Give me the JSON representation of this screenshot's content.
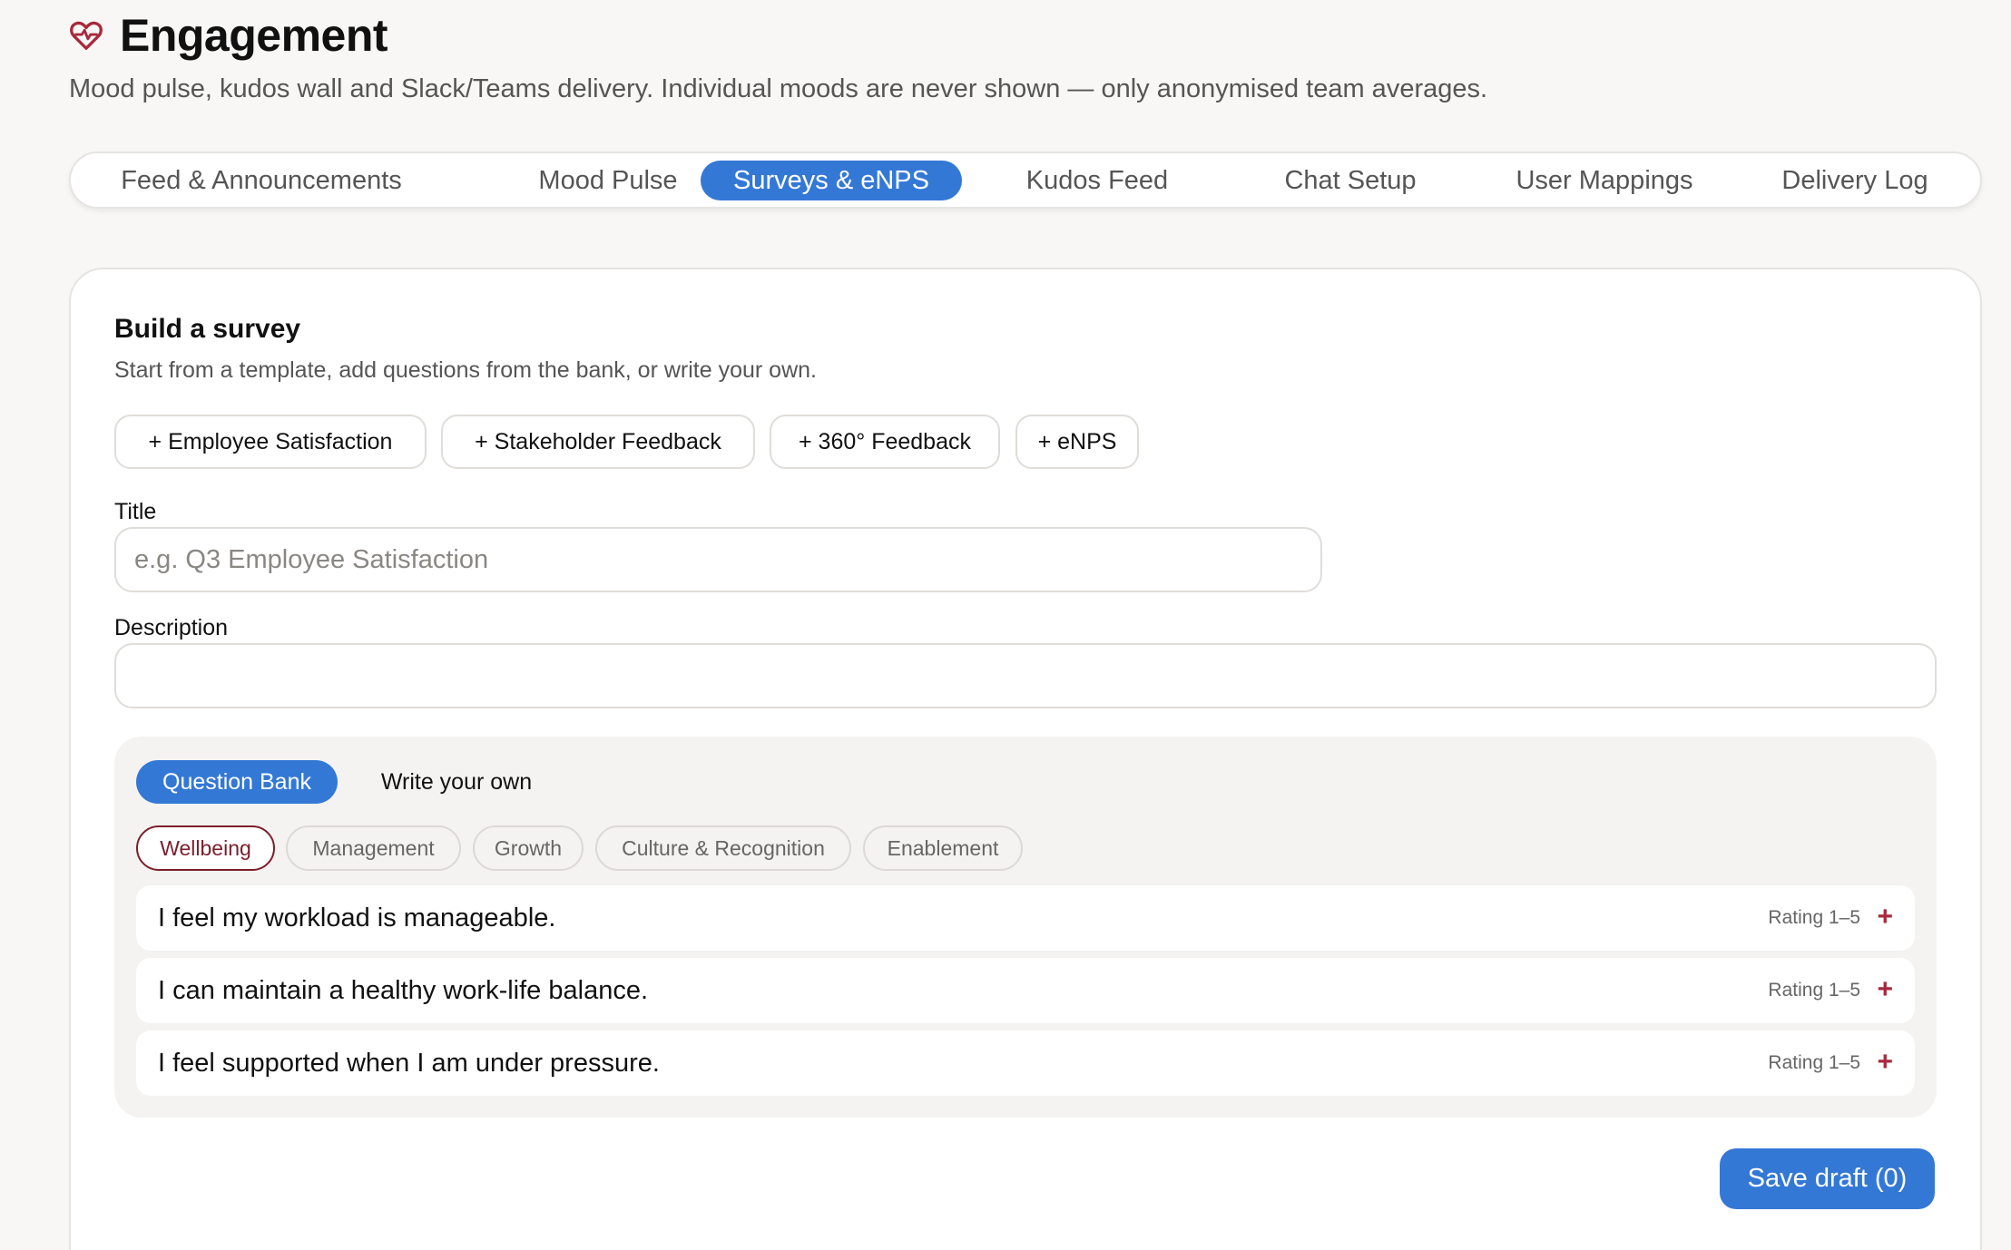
{
  "header": {
    "title": "Engagement",
    "subtitle": "Mood pulse, kudos wall and Slack/Teams delivery. Individual moods are never shown — only anonymised team averages.",
    "icon": "heart-pulse-icon",
    "icon_color": "#a8283c"
  },
  "tabs": [
    {
      "label": "Feed & Announcements"
    },
    {
      "label": "Mood Pulse"
    },
    {
      "label": "Surveys & eNPS",
      "active": true
    },
    {
      "label": "Kudos Feed"
    },
    {
      "label": "Chat Setup"
    },
    {
      "label": "User Mappings"
    },
    {
      "label": "Delivery Log"
    }
  ],
  "builder": {
    "title": "Build a survey",
    "description": "Start from a template, add questions from the bank, or write your own.",
    "templates": [
      {
        "label": "+ Employee Satisfaction"
      },
      {
        "label": "+ Stakeholder Feedback"
      },
      {
        "label": "+ 360° Feedback"
      },
      {
        "label": "+ eNPS"
      }
    ],
    "title_field": {
      "label": "Title",
      "placeholder": "e.g. Q3 Employee Satisfaction",
      "value": ""
    },
    "description_field": {
      "label": "Description",
      "placeholder": "",
      "value": ""
    },
    "modes": {
      "bank": "Question Bank",
      "custom": "Write your own"
    },
    "categories": [
      {
        "label": "Wellbeing",
        "active": true
      },
      {
        "label": "Management"
      },
      {
        "label": "Growth"
      },
      {
        "label": "Culture & Recognition"
      },
      {
        "label": "Enablement"
      }
    ],
    "questions": [
      {
        "text": "I feel my workload is manageable.",
        "type": "Rating 1–5",
        "add": "+"
      },
      {
        "text": "I can maintain a healthy work-life balance.",
        "type": "Rating 1–5",
        "add": "+"
      },
      {
        "text": "I feel supported when I am under pressure.",
        "type": "Rating 1–5",
        "add": "+"
      }
    ],
    "save_label": "Save draft (0)"
  },
  "colors": {
    "accent": "#3478d6",
    "brand": "#a8283c",
    "chip_active": "#7a1f2b"
  }
}
